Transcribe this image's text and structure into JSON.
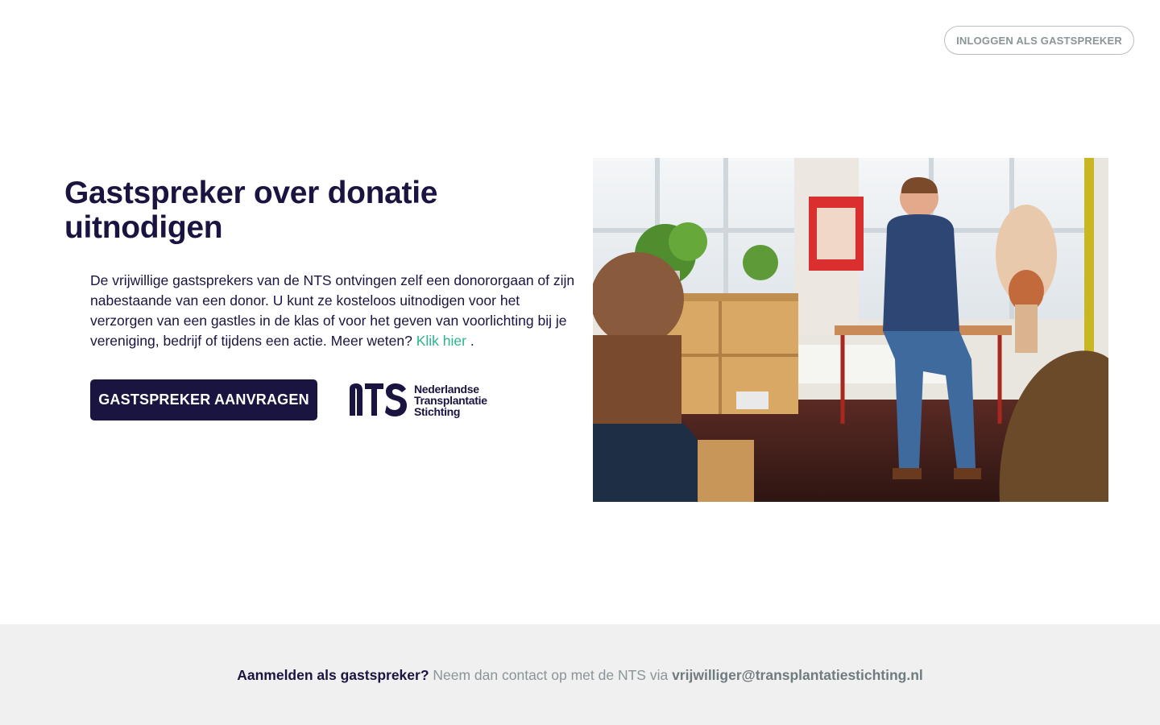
{
  "header": {
    "login_label": "INLOGGEN ALS GASTSPREKER"
  },
  "hero": {
    "title": "Gastspreker over donatie uitnodigen",
    "intro_text": "De vrijwillige gastsprekers van de NTS ontvingen zelf een donororgaan of zijn nabestaande van een donor. U kunt ze kosteloos uitnodigen voor het verzorgen van een gastles in de klas of voor het geven van voorlichting bij je vereniging, bedrijf of tijdens een actie. Meer weten?",
    "intro_link": "Klik hier",
    "intro_end": ".",
    "cta_label": "GASTSPREKER AANVRAGEN",
    "logo": {
      "mark": "NTS",
      "line1": "Nederlandse",
      "line2": "Transplantatie",
      "line3": "Stichting"
    }
  },
  "footer": {
    "lead": "Aanmelden als gastspreker?",
    "text": "Neem dan contact op met de NTS via",
    "email": "vrijwilliger@transplantatiestichting.nl"
  },
  "colors": {
    "brand_navy": "#1a1440",
    "link_green": "#2bb58e",
    "muted_gray": "#8a9599",
    "footer_bg": "#f0f0f0"
  }
}
